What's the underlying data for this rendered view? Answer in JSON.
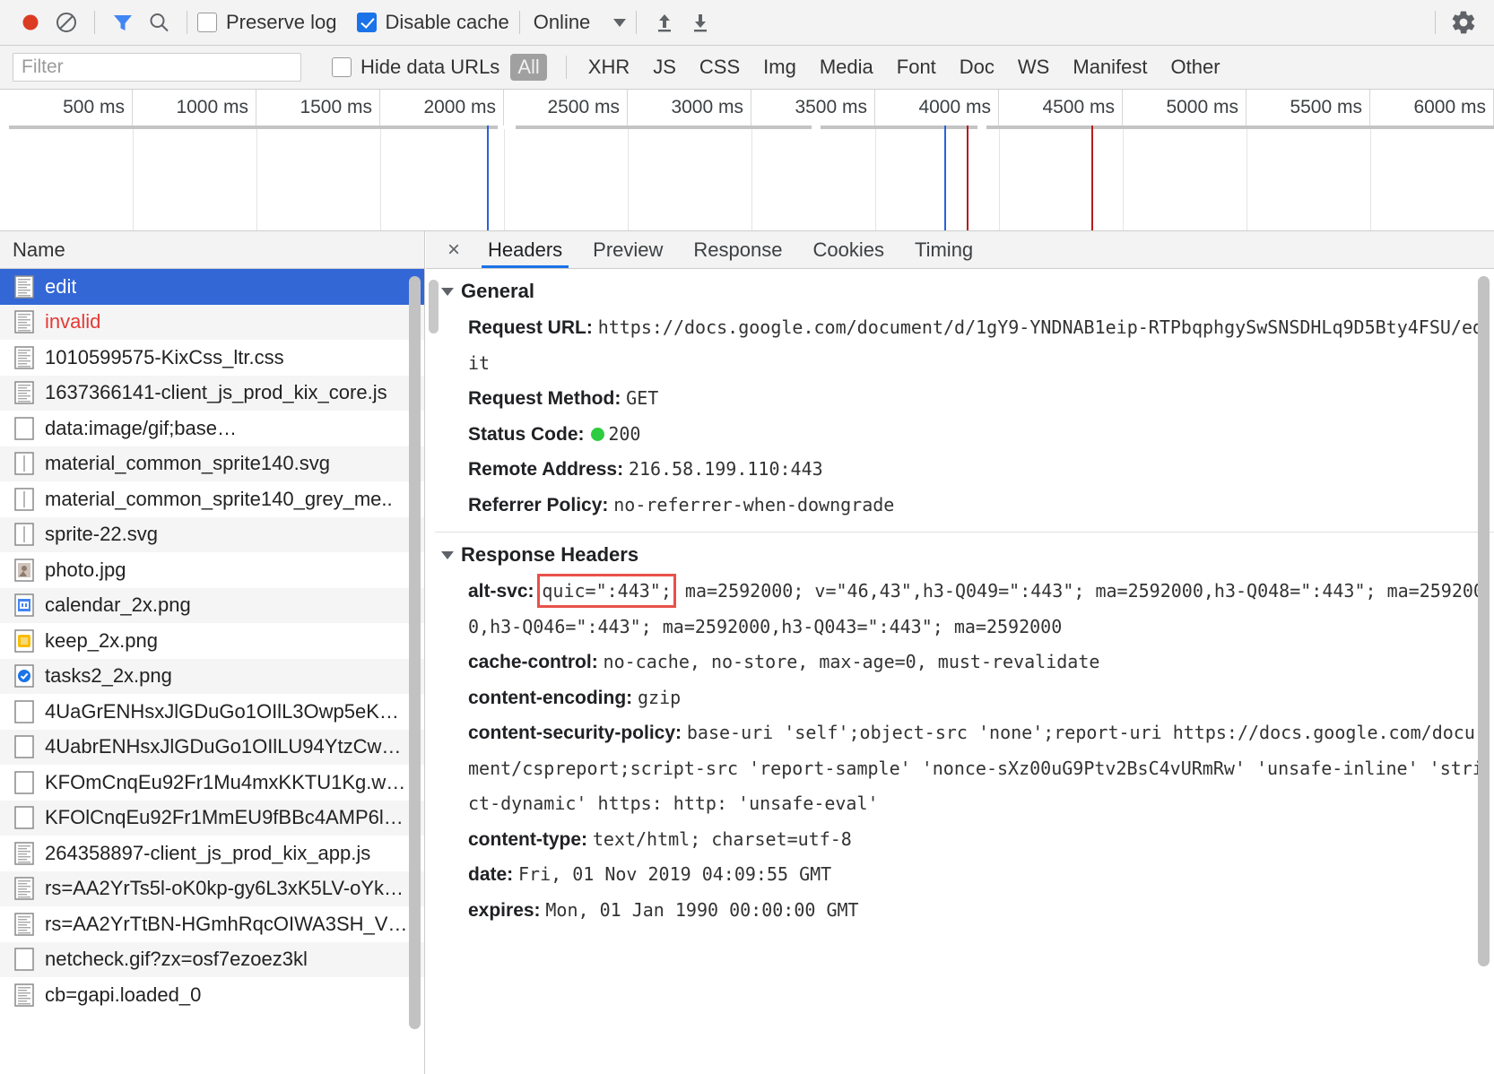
{
  "toolbar": {
    "record_icon": "record-circle-icon",
    "clear_icon": "clear-prohibit-icon",
    "filter_icon": "filter-funnel-icon",
    "search_icon": "search-icon",
    "preserve_log": {
      "label": "Preserve log",
      "checked": false
    },
    "disable_cache": {
      "label": "Disable cache",
      "checked": true
    },
    "throttle": {
      "value": "Online",
      "caret": "chevron-down-icon"
    },
    "import_icon": "upload-arrow-icon",
    "export_icon": "download-arrow-icon",
    "settings_icon": "gear-icon"
  },
  "filterbar": {
    "filter_placeholder": "Filter",
    "filter_value": "",
    "hide_data_urls": {
      "label": "Hide data URLs",
      "checked": false
    },
    "types": [
      "All",
      "XHR",
      "JS",
      "CSS",
      "Img",
      "Media",
      "Font",
      "Doc",
      "WS",
      "Manifest",
      "Other"
    ],
    "active_type": "All"
  },
  "timeline": {
    "ticks": [
      "500 ms",
      "1000 ms",
      "1500 ms",
      "2000 ms",
      "2500 ms",
      "3000 ms",
      "3500 ms",
      "4000 ms",
      "4500 ms",
      "5000 ms",
      "5500 ms",
      "6000 ms"
    ],
    "event_lines": [
      {
        "name": "DOMContentLoaded",
        "time_ms": 1995,
        "color": "#2962d9"
      },
      {
        "name": "DOMContentLoaded",
        "time_ms": 3905,
        "color": "#2962d9"
      },
      {
        "name": "load",
        "time_ms": 4000,
        "color": "#b71c1c"
      },
      {
        "name": "load",
        "time_ms": 4520,
        "color": "#b71c1c"
      }
    ],
    "range_ms": [
      0,
      6200
    ]
  },
  "requests": {
    "column_header": "Name",
    "items": [
      {
        "name": "edit",
        "icon": "document-icon",
        "state": "selected"
      },
      {
        "name": "invalid",
        "icon": "document-icon",
        "state": "error"
      },
      {
        "name": "1010599575-KixCss_ltr.css",
        "icon": "document-icon",
        "state": "normal"
      },
      {
        "name": "1637366141-client_js_prod_kix_core.js",
        "icon": "document-icon",
        "state": "normal"
      },
      {
        "name": "data:image/gif;base…",
        "icon": "blank-icon",
        "state": "normal"
      },
      {
        "name": "material_common_sprite140.svg",
        "icon": "svg-icon",
        "state": "normal"
      },
      {
        "name": "material_common_sprite140_grey_me..",
        "icon": "svg-icon",
        "state": "normal"
      },
      {
        "name": "sprite-22.svg",
        "icon": "svg-icon",
        "state": "normal"
      },
      {
        "name": "photo.jpg",
        "icon": "image-icon",
        "state": "normal"
      },
      {
        "name": "calendar_2x.png",
        "icon": "calendar-image-icon",
        "state": "normal"
      },
      {
        "name": "keep_2x.png",
        "icon": "keep-image-icon",
        "state": "normal"
      },
      {
        "name": "tasks2_2x.png",
        "icon": "tasks-image-icon",
        "state": "normal"
      },
      {
        "name": "4UaGrENHsxJlGDuGo1OIlL3Owp5eK…",
        "icon": "blank-icon",
        "state": "normal"
      },
      {
        "name": "4UabrENHsxJlGDuGo1OIlLU94YtzCw…",
        "icon": "blank-icon",
        "state": "normal"
      },
      {
        "name": "KFOmCnqEu92Fr1Mu4mxKKTU1Kg.w…",
        "icon": "blank-icon",
        "state": "normal"
      },
      {
        "name": "KFOlCnqEu92Fr1MmEU9fBBc4AMP6l…",
        "icon": "blank-icon",
        "state": "normal"
      },
      {
        "name": "264358897-client_js_prod_kix_app.js",
        "icon": "document-icon",
        "state": "normal"
      },
      {
        "name": "rs=AA2YrTs5l-oK0kp-gy6L3xK5LV-oYk…",
        "icon": "document-icon",
        "state": "normal"
      },
      {
        "name": "rs=AA2YrTtBN-HGmhRqcOIWA3SH_V…",
        "icon": "document-icon",
        "state": "normal"
      },
      {
        "name": "netcheck.gif?zx=osf7ezoez3kl",
        "icon": "blank-icon",
        "state": "normal"
      },
      {
        "name": "cb=gapi.loaded_0",
        "icon": "document-icon",
        "state": "normal"
      }
    ]
  },
  "detail": {
    "close_icon": "close-icon",
    "tabs": [
      "Headers",
      "Preview",
      "Response",
      "Cookies",
      "Timing"
    ],
    "active_tab": "Headers",
    "general": {
      "title": "General",
      "rows": [
        {
          "name": "Request URL:",
          "value": "https://docs.google.com/document/d/1gY9-YNDNAB1eip-RTPbqphgySwSNSDHLq9D5Bty4FSU/edit"
        },
        {
          "name": "Request Method:",
          "value": "GET"
        },
        {
          "name": "Status Code:",
          "value": "200",
          "status_dot": "#2ecc40"
        },
        {
          "name": "Remote Address:",
          "value": "216.58.199.110:443"
        },
        {
          "name": "Referrer Policy:",
          "value": "no-referrer-when-downgrade"
        }
      ]
    },
    "response_headers": {
      "title": "Response Headers",
      "rows": [
        {
          "name": "alt-svc:",
          "highlight": "quic=\":443\";",
          "value": " ma=2592000; v=\"46,43\",h3-Q049=\":443\"; ma=2592000,h3-Q048=\":443\"; ma=2592000,h3-Q046=\":443\"; ma=2592000,h3-Q043=\":443\"; ma=2592000"
        },
        {
          "name": "cache-control:",
          "value": "no-cache, no-store, max-age=0, must-revalidate"
        },
        {
          "name": "content-encoding:",
          "value": "gzip"
        },
        {
          "name": "content-security-policy:",
          "value": "base-uri 'self';object-src 'none';report-uri https://docs.google.com/document/cspreport;script-src 'report-sample' 'nonce-sXz00uG9Ptv2BsC4vURmRw' 'unsafe-inline' 'strict-dynamic' https: http: 'unsafe-eval'"
        },
        {
          "name": "content-type:",
          "value": "text/html; charset=utf-8"
        },
        {
          "name": "date:",
          "value": "Fri, 01 Nov 2019 04:09:55 GMT"
        },
        {
          "name": "expires:",
          "value": "Mon, 01 Jan 1990 00:00:00 GMT"
        }
      ]
    }
  }
}
